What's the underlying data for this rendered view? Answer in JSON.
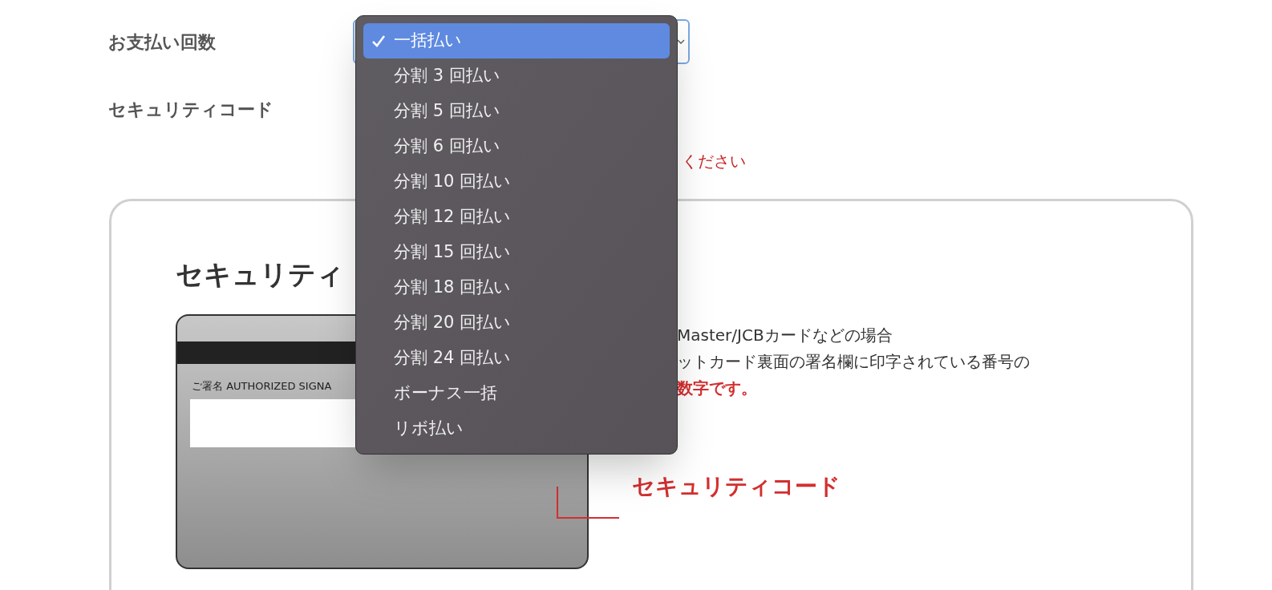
{
  "payment_count": {
    "label": "お支払い回数"
  },
  "security_code": {
    "label": "セキュリティコード",
    "error": "ください"
  },
  "dropdown": {
    "options": [
      {
        "label": "一括払い",
        "selected": true
      },
      {
        "label": "分割 3 回払い",
        "selected": false
      },
      {
        "label": "分割 5 回払い",
        "selected": false
      },
      {
        "label": "分割 6 回払い",
        "selected": false
      },
      {
        "label": "分割 10 回払い",
        "selected": false
      },
      {
        "label": "分割 12 回払い",
        "selected": false
      },
      {
        "label": "分割 15 回払い",
        "selected": false
      },
      {
        "label": "分割 18 回払い",
        "selected": false
      },
      {
        "label": "分割 20 回払い",
        "selected": false
      },
      {
        "label": "分割 24 回払い",
        "selected": false
      },
      {
        "label": "ボーナス一括",
        "selected": false
      },
      {
        "label": "リボ払い",
        "selected": false
      }
    ]
  },
  "guide": {
    "title": "セキュリティ",
    "signature_label": "ご署名 AUTHORIZED SIGNA",
    "lines": [
      {
        "text": "Master/JCBカードなどの場合",
        "kind": "note"
      },
      {
        "text": "ットカード裏面の署名欄に印字されている番号の",
        "kind": "note"
      },
      {
        "text": "数字です。",
        "kind": "emphasis"
      }
    ],
    "callout": "セキュリティコード"
  }
}
